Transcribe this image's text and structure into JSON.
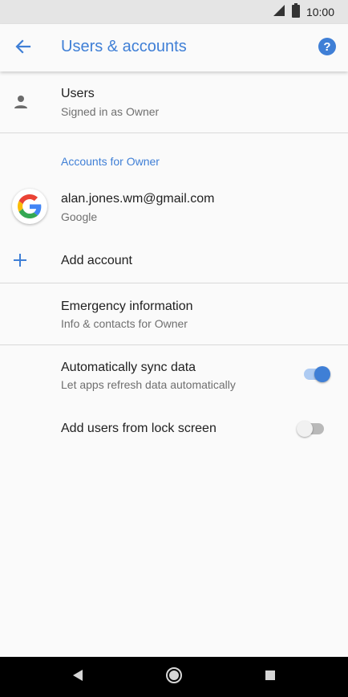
{
  "status_bar": {
    "time": "10:00"
  },
  "app_bar": {
    "title": "Users & accounts",
    "help_label": "?"
  },
  "users": {
    "title": "Users",
    "subtitle": "Signed in as Owner"
  },
  "accounts_section": {
    "header": "Accounts for Owner"
  },
  "google_account": {
    "email": "alan.jones.wm@gmail.com",
    "provider": "Google"
  },
  "add_account": {
    "label": "Add account"
  },
  "emergency": {
    "title": "Emergency information",
    "subtitle": "Info & contacts for Owner"
  },
  "auto_sync": {
    "title": "Automatically sync data",
    "subtitle": "Let apps refresh data automatically",
    "enabled": true
  },
  "lock_screen_users": {
    "title": "Add users from lock screen",
    "enabled": false
  },
  "icons": {
    "back": "arrow-back-icon",
    "help": "help-icon",
    "person": "person-icon",
    "google": "google-logo-icon",
    "add": "plus-icon",
    "nav_back": "nav-back-icon",
    "nav_home": "nav-home-icon",
    "nav_recents": "nav-recents-icon"
  },
  "colors": {
    "accent": "#3f7fd6",
    "toggle_on_thumb": "#3f7fd6",
    "toggle_on_track": "#aecbf2",
    "toggle_off_thumb": "#f1f1f1",
    "toggle_off_track": "#b9b9b9"
  }
}
